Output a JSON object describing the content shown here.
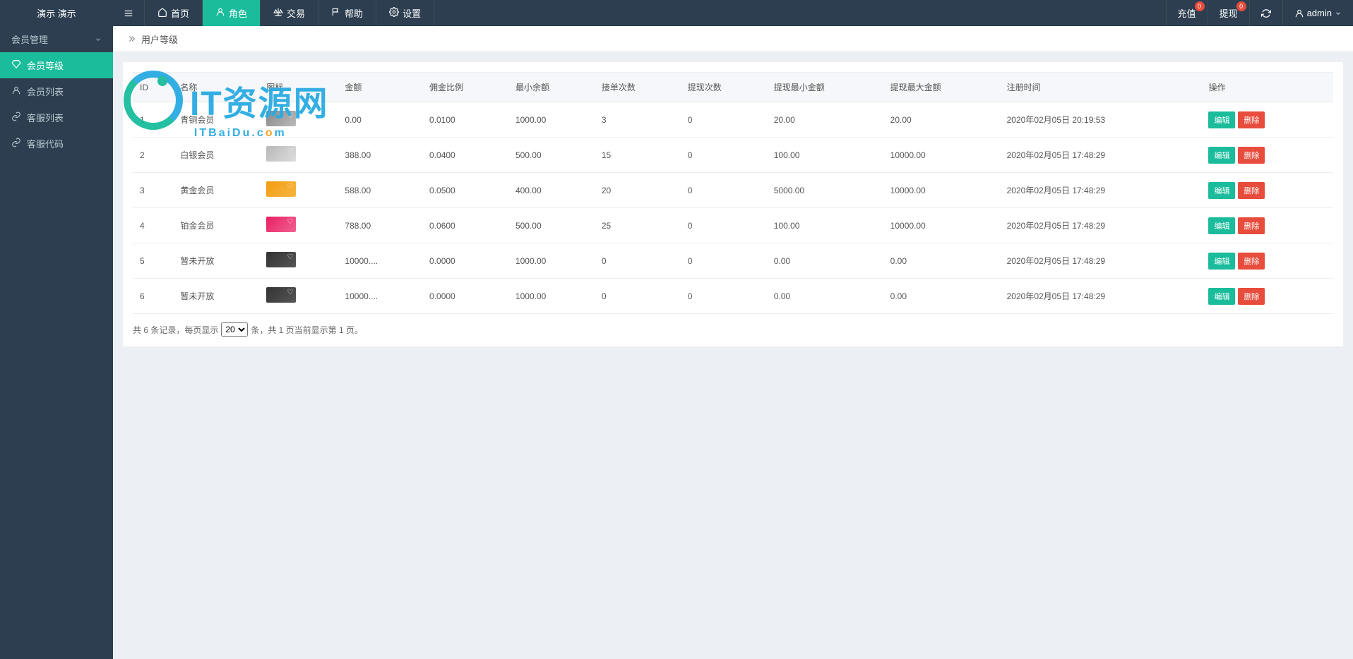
{
  "logo_text": "演示        演示",
  "top_nav": [
    {
      "label": "首页",
      "icon": "home"
    },
    {
      "label": "角色",
      "icon": "user",
      "active": true
    },
    {
      "label": "交易",
      "icon": "scale"
    },
    {
      "label": "帮助",
      "icon": "flag"
    },
    {
      "label": "设置",
      "icon": "gear"
    }
  ],
  "header_right": {
    "recharge": {
      "label": "充值",
      "badge": "0"
    },
    "withdraw": {
      "label": "提现",
      "badge": "0"
    },
    "user": "admin"
  },
  "sidebar": {
    "group_label": "会员管理",
    "items": [
      {
        "label": "会员等级",
        "icon": "diamond",
        "active": true
      },
      {
        "label": "会员列表",
        "icon": "user"
      },
      {
        "label": "客服列表",
        "icon": "link"
      },
      {
        "label": "客服代码",
        "icon": "link"
      }
    ]
  },
  "breadcrumb": {
    "title": "用户等级"
  },
  "table": {
    "columns": [
      "ID",
      "名称",
      "图标",
      "金额",
      "佣金比例",
      "最小余额",
      "接单次数",
      "提现次数",
      "提现最小金额",
      "提现最大金额",
      "注册时间",
      "操作"
    ],
    "rows": [
      {
        "id": "1",
        "name": "青铜会员",
        "thumb": "gray",
        "amount": "0.00",
        "ratio": "0.0100",
        "min_balance": "1000.00",
        "order_count": "3",
        "withdraw_count": "0",
        "withdraw_min": "20.00",
        "withdraw_max": "20.00",
        "created": "2020年02月05日 20:19:53"
      },
      {
        "id": "2",
        "name": "白银会员",
        "thumb": "silver",
        "amount": "388.00",
        "ratio": "0.0400",
        "min_balance": "500.00",
        "order_count": "15",
        "withdraw_count": "0",
        "withdraw_min": "100.00",
        "withdraw_max": "10000.00",
        "created": "2020年02月05日 17:48:29"
      },
      {
        "id": "3",
        "name": "黄金会员",
        "thumb": "gold",
        "amount": "588.00",
        "ratio": "0.0500",
        "min_balance": "400.00",
        "order_count": "20",
        "withdraw_count": "0",
        "withdraw_min": "5000.00",
        "withdraw_max": "10000.00",
        "created": "2020年02月05日 17:48:29"
      },
      {
        "id": "4",
        "name": "铂金会员",
        "thumb": "pink",
        "amount": "788.00",
        "ratio": "0.0600",
        "min_balance": "500.00",
        "order_count": "25",
        "withdraw_count": "0",
        "withdraw_min": "100.00",
        "withdraw_max": "10000.00",
        "created": "2020年02月05日 17:48:29"
      },
      {
        "id": "5",
        "name": "暂未开放",
        "thumb": "dark",
        "amount": "10000....",
        "ratio": "0.0000",
        "min_balance": "1000.00",
        "order_count": "0",
        "withdraw_count": "0",
        "withdraw_min": "0.00",
        "withdraw_max": "0.00",
        "created": "2020年02月05日 17:48:29"
      },
      {
        "id": "6",
        "name": "暂未开放",
        "thumb": "dark",
        "amount": "10000....",
        "ratio": "0.0000",
        "min_balance": "1000.00",
        "order_count": "0",
        "withdraw_count": "0",
        "withdraw_min": "0.00",
        "withdraw_max": "0.00",
        "created": "2020年02月05日 17:48:29"
      }
    ],
    "edit_label": "编辑",
    "delete_label": "删除"
  },
  "pager": {
    "prefix": "共 6 条记录，每页显示",
    "page_size": "20",
    "suffix": "条，共 1 页当前显示第 1 页。"
  },
  "watermark": {
    "main": "IT资源网",
    "sub_prefix": "ITBaiDu.c",
    "sub_o": "o",
    "sub_suffix": "m"
  }
}
